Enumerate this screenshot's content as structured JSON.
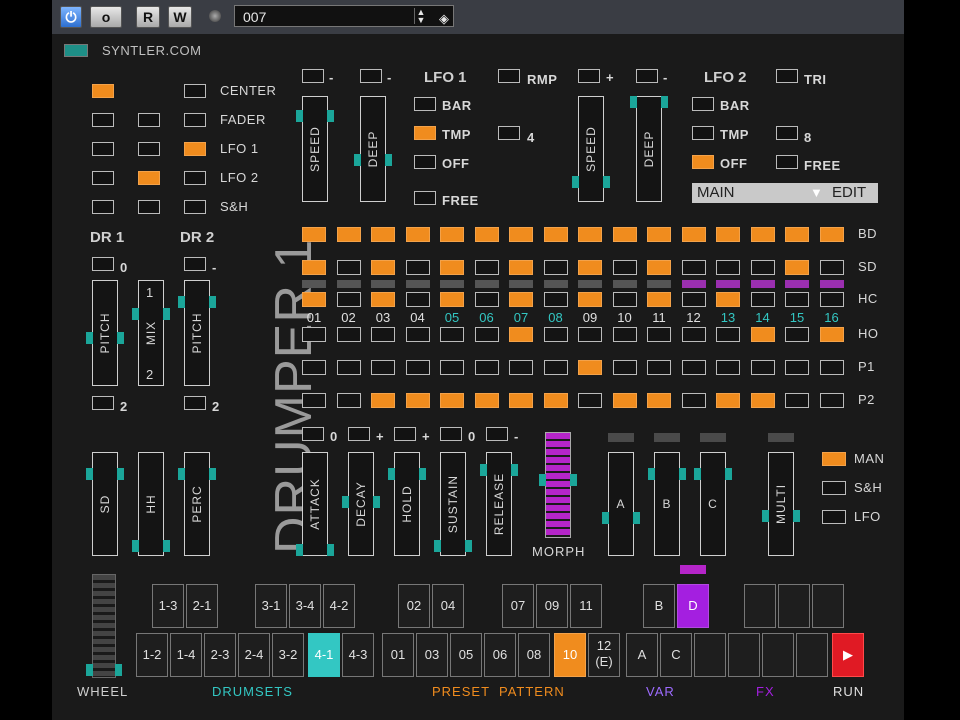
{
  "toolbar": {
    "power_icon": "power-icon",
    "btn_o": "o",
    "btn_r": "R",
    "btn_w": "W",
    "preset_name": "007"
  },
  "header": {
    "site": "SYNTLER.COM"
  },
  "routing": {
    "labels": [
      "CENTER",
      "FADER",
      "LFO 1",
      "LFO 2",
      "S&H"
    ]
  },
  "dr": {
    "dr1": "DR 1",
    "dr2": "DR 2",
    "dr1_top": "0",
    "dr1_bottom": "2",
    "dr2_top": "-",
    "dr2_bottom": "2",
    "pitch": "PITCH",
    "mix": "MIX",
    "mix_top": "1",
    "mix_bottom": "2"
  },
  "lfo1": {
    "title": "LFO 1",
    "rmp": "RMP",
    "bar": "BAR",
    "tmp": "TMP",
    "off": "OFF",
    "free": "FREE",
    "four": "4",
    "speed": "SPEED",
    "deep": "DEEP",
    "speed_top": "-",
    "deep_top": "-"
  },
  "lfo2": {
    "title": "LFO 2",
    "tri": "TRI",
    "bar": "BAR",
    "tmp": "TMP",
    "off": "OFF",
    "free": "FREE",
    "eight": "8",
    "speed": "SPEED",
    "deep": "DEEP",
    "speed_top": "+",
    "deep_top": "-"
  },
  "mainbox": {
    "main": "MAIN",
    "edit": "EDIT"
  },
  "logo": "DRUMPER 1",
  "sequencer": {
    "steps": [
      "01",
      "02",
      "03",
      "04",
      "05",
      "06",
      "07",
      "08",
      "09",
      "10",
      "11",
      "12",
      "13",
      "14",
      "15",
      "16"
    ],
    "rows": [
      "BD",
      "SD",
      "HC",
      "HO",
      "P1",
      "P2"
    ]
  },
  "env": {
    "attack": "ATTACK",
    "decay": "DECAY",
    "hold": "HOLD",
    "sustain": "SUSTAIN",
    "release": "RELEASE",
    "a_top": "0",
    "d_top": "+",
    "h_top": "+",
    "s_top": "0",
    "r_top": "-"
  },
  "morph": "MORPH",
  "abc": {
    "a": "A",
    "b": "B",
    "c": "C",
    "multi": "MULTI"
  },
  "modsrc": {
    "man": "MAN",
    "sh": "S&H",
    "lfo": "LFO"
  },
  "mix3": {
    "sd": "SD",
    "hh": "HH",
    "perc": "PERC"
  },
  "bottom": {
    "wheel": "WHEEL",
    "drumsets": "DRUMSETS",
    "preset": "PRESET  PATTERN",
    "var": "VAR",
    "fx": "FX",
    "run": "RUN",
    "drum_top": [
      "1-3",
      "2-1",
      "3-1",
      "3-4",
      "4-2"
    ],
    "drum_bot": [
      "1-2",
      "1-4",
      "2-3",
      "2-4",
      "3-2",
      "4-1",
      "4-3"
    ],
    "pat_top": [
      "02",
      "04",
      "07",
      "09",
      "11"
    ],
    "pat_bot": [
      "01",
      "03",
      "05",
      "06",
      "08",
      "10",
      "12 (E)"
    ],
    "var_top": [
      "B",
      "D"
    ],
    "var_bot": [
      "A",
      "C"
    ]
  },
  "colors": {
    "accent": "#f08c1e",
    "teal": "#33c7c3",
    "purple": "#a41fe0",
    "run": "#e01a24"
  }
}
